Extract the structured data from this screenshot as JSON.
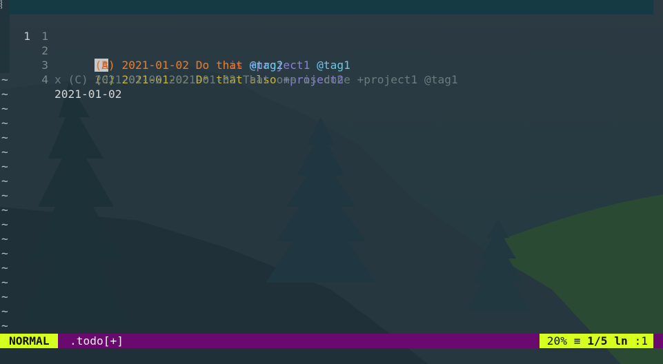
{
  "editor": {
    "cursor_line": {
      "number": "1",
      "cursor_char": "(A",
      "after_cursor": ")",
      "date": "2021-01-02",
      "task": "Do this",
      "project": "+project1",
      "tag": "@tag1"
    },
    "lines": [
      {
        "number": "1",
        "priority": "(B)",
        "date": "2021-01-02",
        "task": "Do that",
        "tag": "@tag2"
      },
      {
        "number": "2",
        "priority": "(C)",
        "date": "2021-01-02",
        "task": "Do that also",
        "project": "+project2"
      },
      {
        "number": "3",
        "text": "x (C) 2021-01-02 2021-01-02 That one is done +project1 @tag1"
      },
      {
        "number": "4",
        "text": "2021-01-02"
      }
    ],
    "tilde": "~"
  },
  "statusline": {
    "mode": "NORMAL",
    "filename": ".todo[+]",
    "percent": "20%",
    "lines_icon": "≡",
    "position": "1/5",
    "ln_label": "ln",
    "column": ":1"
  },
  "colors": {
    "priority_a": "#d0453b",
    "priority_b": "#dd7d2a",
    "priority_c": "#c5b43a",
    "done": "#6b7b7e",
    "project": "#8c7fd8",
    "tag": "#6cc6e6",
    "mode_bg": "#d7ff1f",
    "statusline_bg": "#6b0a6e"
  }
}
